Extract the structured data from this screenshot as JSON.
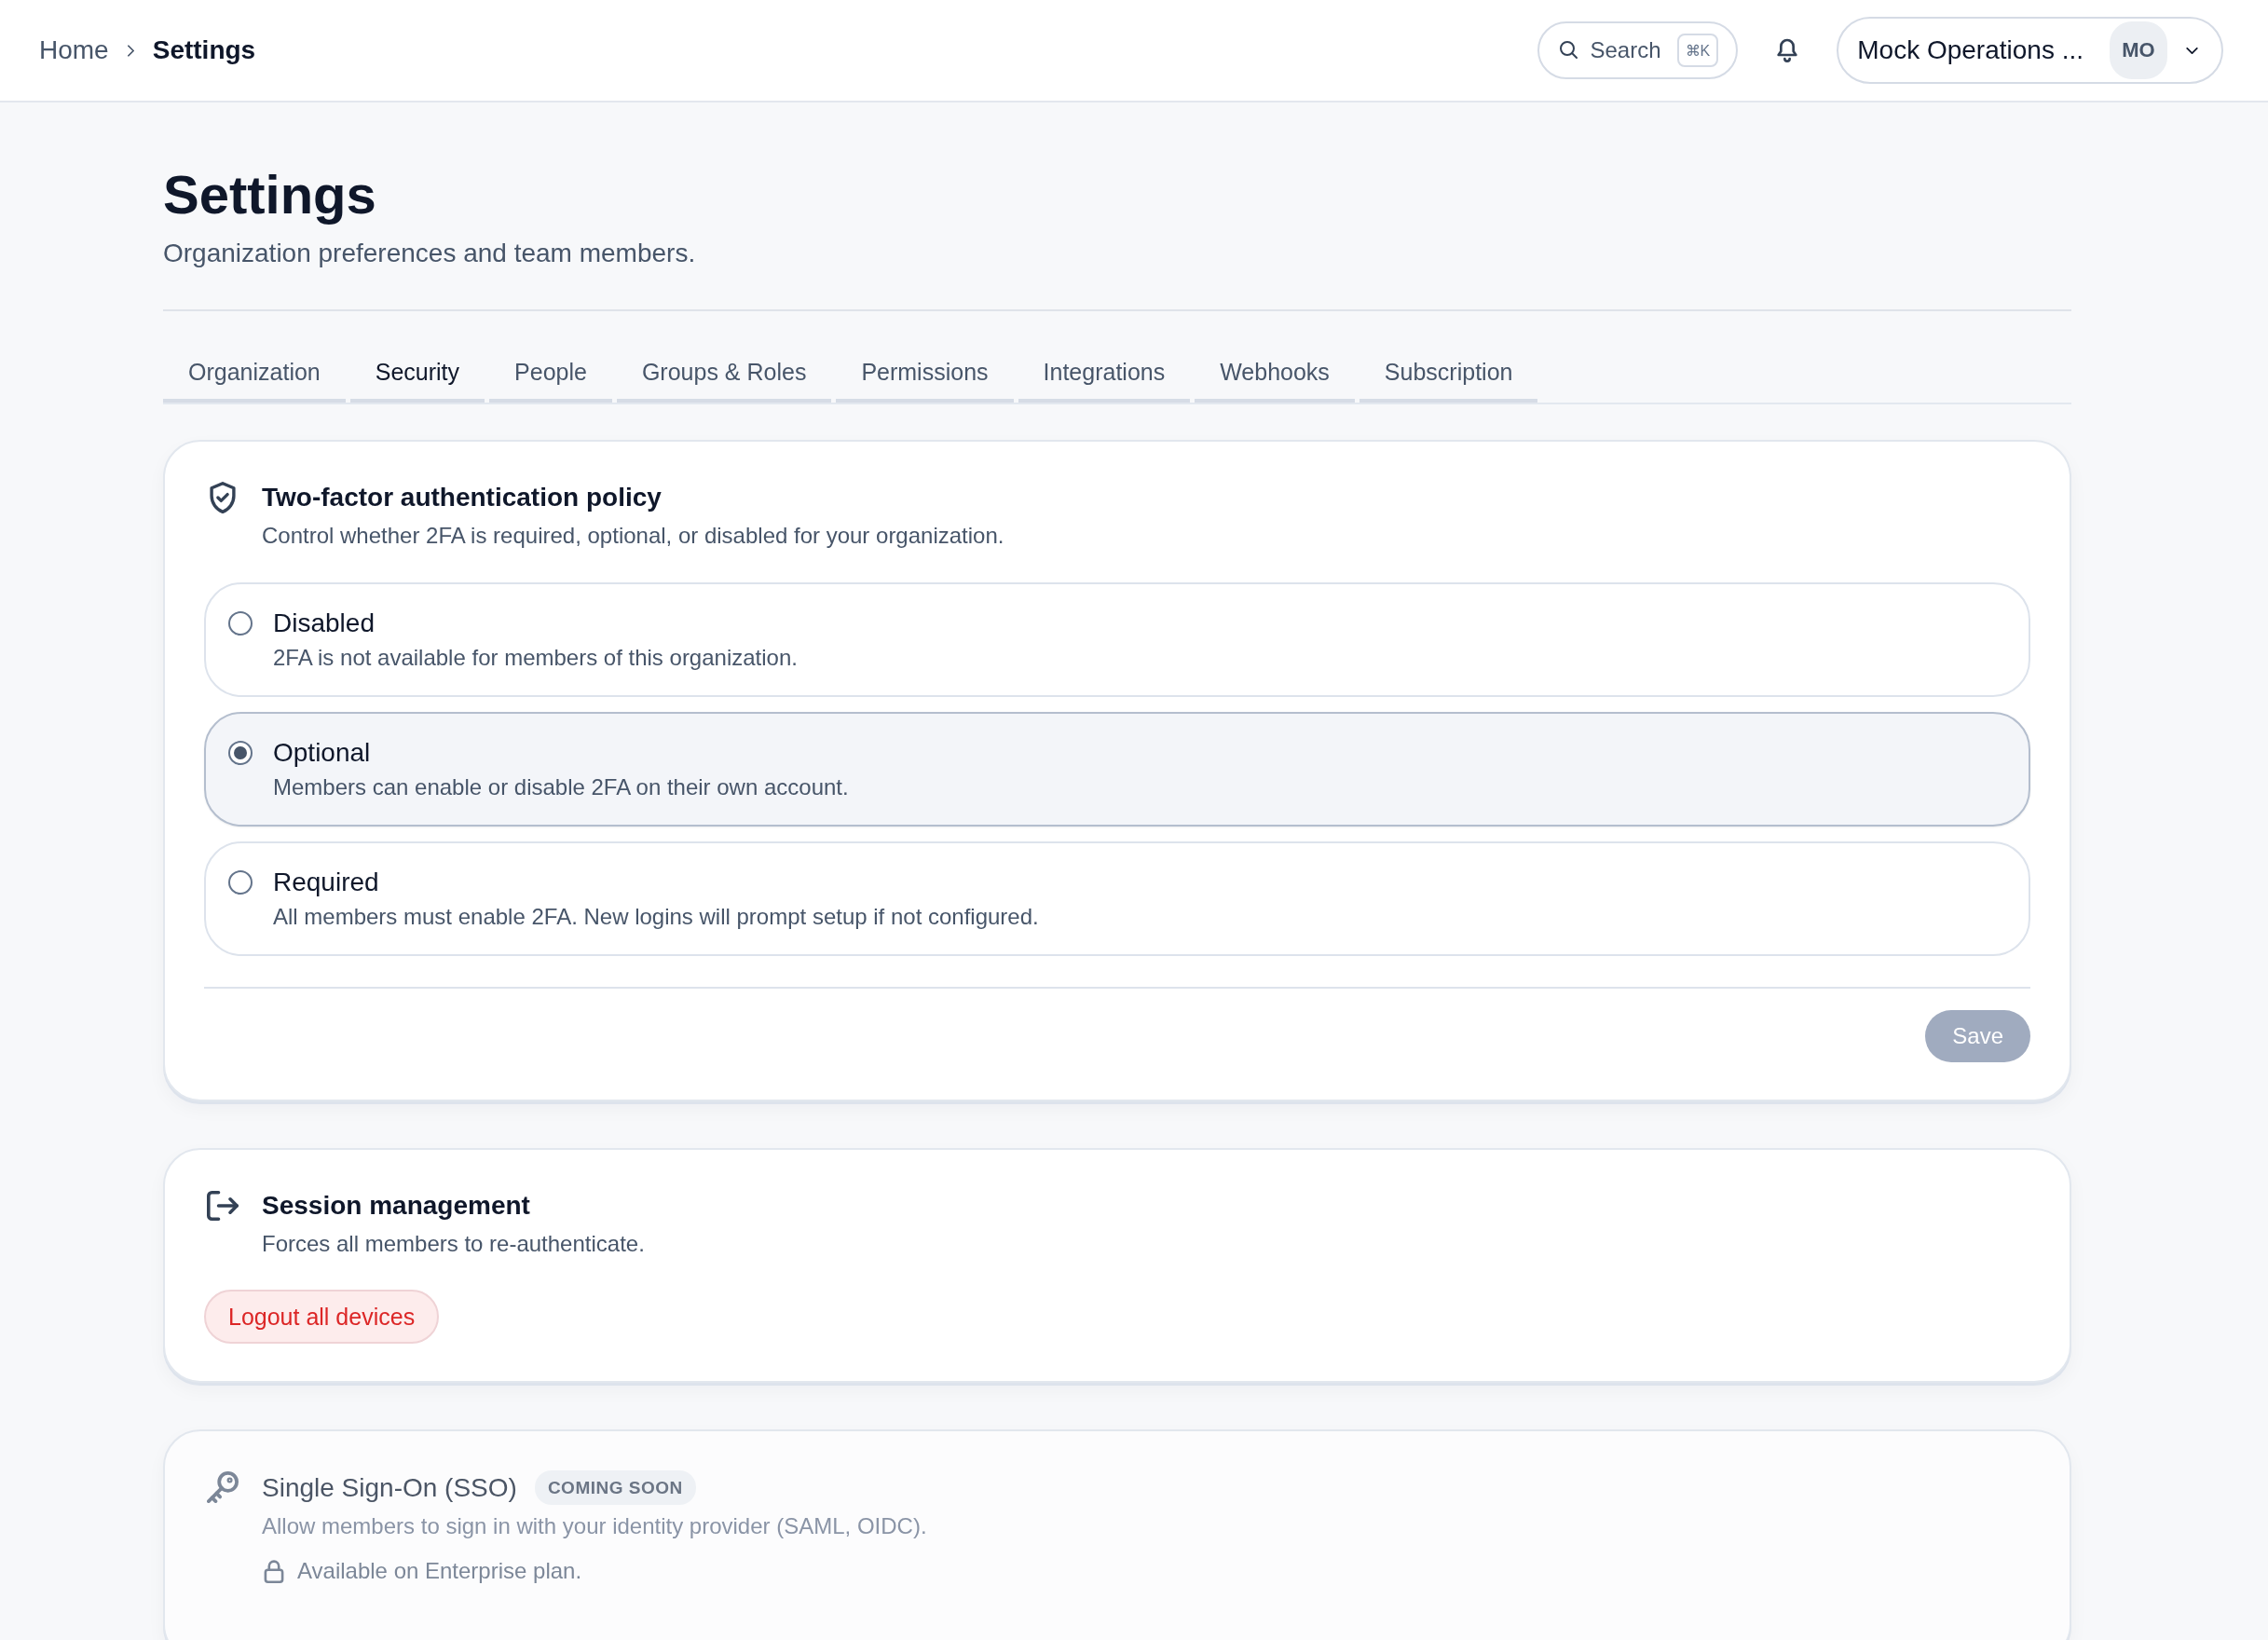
{
  "topbar": {
    "breadcrumb": [
      {
        "label": "Home",
        "current": false
      },
      {
        "label": "Settings",
        "current": true
      }
    ],
    "search": {
      "label": "Search",
      "shortcut": "⌘K"
    },
    "account": {
      "name": "Mock Operations ...",
      "initials": "MO"
    }
  },
  "header": {
    "title": "Settings",
    "subtitle": "Organization preferences and team members."
  },
  "tabs": [
    {
      "label": "Organization",
      "selected": false
    },
    {
      "label": "Security",
      "selected": true
    },
    {
      "label": "People",
      "selected": false
    },
    {
      "label": "Groups & Roles",
      "selected": false
    },
    {
      "label": "Permissions",
      "selected": false
    },
    {
      "label": "Integrations",
      "selected": false
    },
    {
      "label": "Webhooks",
      "selected": false
    },
    {
      "label": "Subscription",
      "selected": false
    }
  ],
  "two_factor": {
    "title": "Two-factor authentication policy",
    "description": "Control whether 2FA is required, optional, or disabled for your organization.",
    "options": [
      {
        "label": "Disabled",
        "description": "2FA is not available for members of this organization.",
        "selected": false
      },
      {
        "label": "Optional",
        "description": "Members can enable or disable 2FA on their own account.",
        "selected": true
      },
      {
        "label": "Required",
        "description": "All members must enable 2FA. New logins will prompt setup if not configured.",
        "selected": false
      }
    ],
    "save": {
      "label": "Save",
      "disabled": true
    }
  },
  "session": {
    "title": "Session management",
    "description": "Forces all members to re-authenticate.",
    "button": "Logout all devices"
  },
  "sso": {
    "title": "Single Sign-On (SSO)",
    "badge": "COMING SOON",
    "description": "Allow members to sign in with your identity provider (SAML, OIDC).",
    "note": "Available on Enterprise plan.",
    "disabled": true
  }
}
